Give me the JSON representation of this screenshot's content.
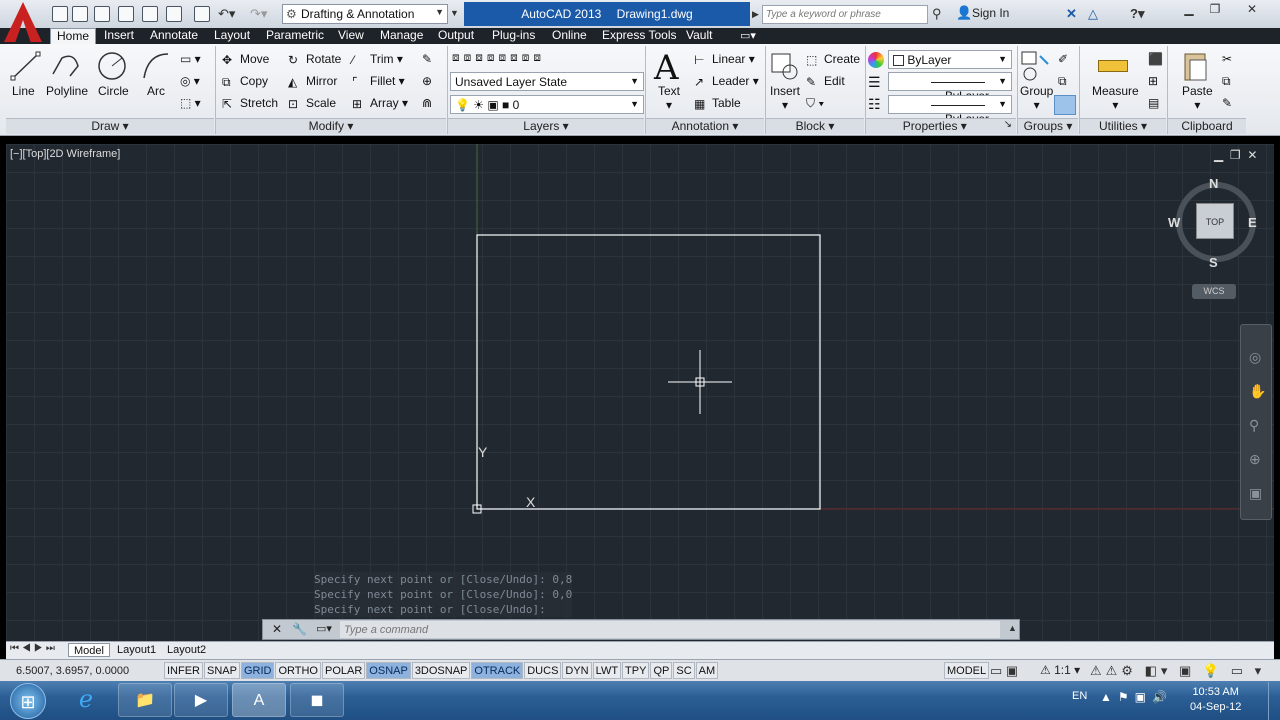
{
  "title": {
    "workspace": "Drafting & Annotation",
    "app_name": "AutoCAD 2013",
    "document": "Drawing1.dwg",
    "search_placeholder": "Type a keyword or phrase",
    "sign_in": "Sign In"
  },
  "menu_tabs": [
    "Home",
    "Insert",
    "Annotate",
    "Layout",
    "Parametric",
    "View",
    "Manage",
    "Output",
    "Plug-ins",
    "Online",
    "Express Tools",
    "Vault"
  ],
  "ribbon": {
    "draw": {
      "title": "Draw",
      "line": "Line",
      "polyline": "Polyline",
      "circle": "Circle",
      "arc": "Arc"
    },
    "modify": {
      "title": "Modify",
      "move": "Move",
      "rotate": "Rotate",
      "trim": "Trim",
      "copy": "Copy",
      "mirror": "Mirror",
      "fillet": "Fillet",
      "stretch": "Stretch",
      "scale": "Scale",
      "array": "Array"
    },
    "layers": {
      "title": "Layers",
      "layer_state": "Unsaved Layer State",
      "current_layer": "0"
    },
    "annotation": {
      "title": "Annotation",
      "text": "Text",
      "linear": "Linear",
      "leader": "Leader",
      "table": "Table"
    },
    "block": {
      "title": "Block",
      "insert": "Insert",
      "create": "Create",
      "edit": "Edit"
    },
    "properties": {
      "title": "Properties",
      "color": "ByLayer",
      "lineweight": "ByLayer",
      "linetype": "ByLayer"
    },
    "groups": {
      "title": "Groups",
      "group": "Group"
    },
    "utilities": {
      "title": "Utilities",
      "measure": "Measure"
    },
    "clipboard": {
      "title": "Clipboard",
      "paste": "Paste"
    }
  },
  "viewport": {
    "label": "[−][Top][2D Wireframe]",
    "viewcube": {
      "n": "N",
      "s": "S",
      "e": "E",
      "w": "W",
      "top": "TOP",
      "wcs": "WCS"
    },
    "ucs_y": "Y",
    "ucs_x": "X"
  },
  "command": {
    "history": [
      "Specify next point or [Close/Undo]: 0,8",
      "Specify next point or [Close/Undo]: 0,0",
      "Specify next point or [Close/Undo]:"
    ],
    "placeholder": "Type a command"
  },
  "layout_tabs": [
    "Model",
    "Layout1",
    "Layout2"
  ],
  "status": {
    "coords": "6.5007, 3.6957, 0.0000",
    "toggles": [
      {
        "label": "INFER",
        "on": false
      },
      {
        "label": "SNAP",
        "on": false
      },
      {
        "label": "GRID",
        "on": true
      },
      {
        "label": "ORTHO",
        "on": false
      },
      {
        "label": "POLAR",
        "on": false
      },
      {
        "label": "OSNAP",
        "on": true
      },
      {
        "label": "3DOSNAP",
        "on": false
      },
      {
        "label": "OTRACK",
        "on": true
      },
      {
        "label": "DUCS",
        "on": false
      },
      {
        "label": "DYN",
        "on": false
      },
      {
        "label": "LWT",
        "on": false
      },
      {
        "label": "TPY",
        "on": false
      },
      {
        "label": "QP",
        "on": false
      },
      {
        "label": "SC",
        "on": false
      },
      {
        "label": "AM",
        "on": false
      }
    ],
    "model": "MODEL",
    "scale": "1:1"
  },
  "taskbar": {
    "lang": "EN",
    "time": "10:53 AM",
    "date": "04-Sep-12"
  },
  "colors": {
    "canvas": "#212830",
    "accent": "#1b5aa8",
    "status_on": "#8db2de"
  }
}
